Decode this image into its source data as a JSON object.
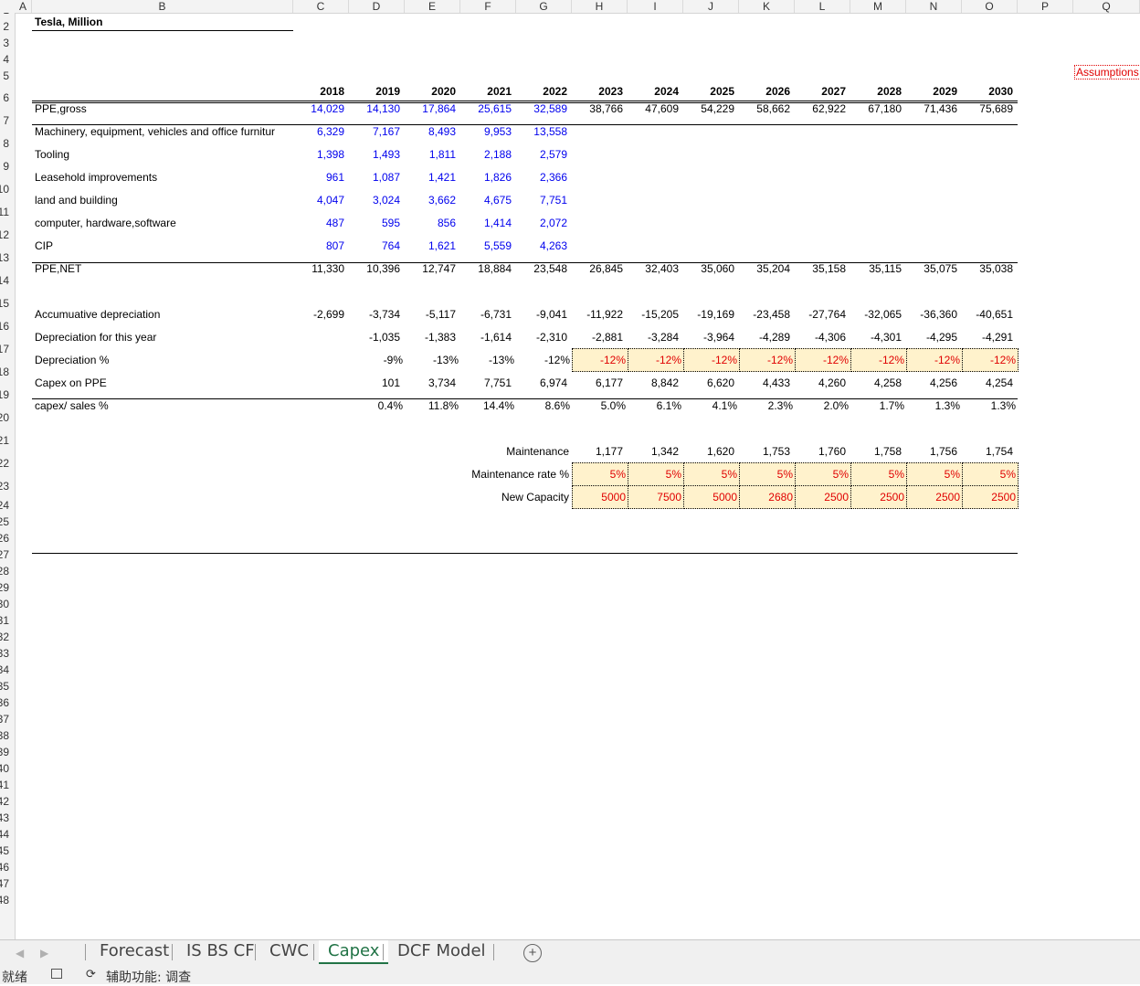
{
  "columns": [
    "A",
    "B",
    "C",
    "D",
    "E",
    "F",
    "G",
    "H",
    "I",
    "J",
    "K",
    "L",
    "M",
    "N",
    "O",
    "P",
    "Q"
  ],
  "rows": [
    "1",
    "2",
    "3",
    "4",
    "5",
    "6",
    "7",
    "8",
    "9",
    "10",
    "11",
    "12",
    "13",
    "14",
    "15",
    "16",
    "17",
    "18",
    "19",
    "20",
    "21",
    "22",
    "23",
    "24",
    "25",
    "26",
    "27",
    "28",
    "29",
    "30",
    "31",
    "32",
    "33",
    "34",
    "35",
    "36",
    "37",
    "38",
    "39",
    "40",
    "41",
    "42",
    "43",
    "44",
    "45",
    "46",
    "47",
    "48"
  ],
  "title": "Tesla, Million",
  "assumptions_label": "Assumptions",
  "years": [
    "2018",
    "2019",
    "2020",
    "2021",
    "2022",
    "2023",
    "2024",
    "2025",
    "2026",
    "2027",
    "2028",
    "2029",
    "2030"
  ],
  "table": [
    {
      "label": "PPE,gross",
      "values": [
        "14,029",
        "14,130",
        "17,864",
        "25,615",
        "32,589",
        "38,766",
        "47,609",
        "54,229",
        "58,662",
        "62,922",
        "67,180",
        "71,436",
        "75,689"
      ],
      "hist_blue": true
    },
    {
      "label": "Machinery, equipment, vehicles and office furnitur",
      "values": [
        "6,329",
        "7,167",
        "8,493",
        "9,953",
        "13,558"
      ],
      "hist_blue": true
    },
    {
      "label": "Tooling",
      "values": [
        "1,398",
        "1,493",
        "1,811",
        "2,188",
        "2,579"
      ],
      "hist_blue": true
    },
    {
      "label": "Leasehold improvements",
      "values": [
        "961",
        "1,087",
        "1,421",
        "1,826",
        "2,366"
      ],
      "hist_blue": true
    },
    {
      "label": "land and building",
      "values": [
        "4,047",
        "3,024",
        "3,662",
        "4,675",
        "7,751"
      ],
      "hist_blue": true
    },
    {
      "label": "computer, hardware,software",
      "values": [
        "487",
        "595",
        "856",
        "1,414",
        "2,072"
      ],
      "hist_blue": true
    },
    {
      "label": "CIP",
      "values": [
        "807",
        "764",
        "1,621",
        "5,559",
        "4,263"
      ],
      "hist_blue": true
    },
    {
      "label": "PPE,NET",
      "values": [
        "11,330",
        "10,396",
        "12,747",
        "18,884",
        "23,548",
        "26,845",
        "32,403",
        "35,060",
        "35,204",
        "35,158",
        "35,115",
        "35,075",
        "35,038"
      ],
      "hist_blue": false
    },
    {
      "label": "",
      "values": []
    },
    {
      "label": "Accumuative depreciation",
      "values": [
        "-2,699",
        "-3,734",
        "-5,117",
        "-6,731",
        "-9,041",
        "-11,922",
        "-15,205",
        "-19,169",
        "-23,458",
        "-27,764",
        "-32,065",
        "-36,360",
        "-40,651"
      ],
      "hist_blue": false
    },
    {
      "label": "Depreciation for this year",
      "values": [
        "",
        "-1,035",
        "-1,383",
        "-1,614",
        "-2,310",
        "-2,881",
        "-3,284",
        "-3,964",
        "-4,289",
        "-4,306",
        "-4,301",
        "-4,295",
        "-4,291"
      ],
      "hist_blue": false
    },
    {
      "label": "Depreciation %",
      "values": [
        "",
        "-9%",
        "-13%",
        "-13%",
        "-12%",
        "-12%",
        "-12%",
        "-12%",
        "-12%",
        "-12%",
        "-12%",
        "-12%",
        "-12%"
      ],
      "hist_blue": false
    },
    {
      "label": "Capex on PPE",
      "values": [
        "",
        "101",
        "3,734",
        "7,751",
        "6,974",
        "6,177",
        "8,842",
        "6,620",
        "4,433",
        "4,260",
        "4,258",
        "4,256",
        "4,254"
      ],
      "hist_blue": false
    },
    {
      "label": "capex/ sales %",
      "values": [
        "",
        "0.4%",
        "11.8%",
        "14.4%",
        "8.6%",
        "5.0%",
        "6.1%",
        "4.1%",
        "2.3%",
        "2.0%",
        "1.7%",
        "1.3%",
        "1.3%"
      ],
      "hist_blue": false
    }
  ],
  "lower": [
    {
      "label": "Maintenance",
      "values": [
        "1,177",
        "1,342",
        "1,620",
        "1,753",
        "1,760",
        "1,758",
        "1,756",
        "1,754"
      ],
      "input": false
    },
    {
      "label": "Maintenance rate %",
      "values": [
        "5%",
        "5%",
        "5%",
        "5%",
        "5%",
        "5%",
        "5%",
        "5%"
      ],
      "input": true
    },
    {
      "label": "New Capacity",
      "values": [
        "5000",
        "7500",
        "5000",
        "2680",
        "2500",
        "2500",
        "2500",
        "2500"
      ],
      "input": true
    }
  ],
  "tabs": [
    "Forecast",
    "IS BS CF",
    "CWC",
    "Capex",
    "DCF Model"
  ],
  "active_tab": "Capex",
  "status": {
    "ready": "就绪",
    "accessibility": "辅助功能: 调查"
  },
  "colors": {
    "input_fill": "#fff2cc",
    "input_text": "#e00000",
    "hist_text": "#0000ee",
    "active_tab": "#217346"
  },
  "icons": {
    "add_sheet": "plus-circle-icon",
    "prev": "chevron-left-icon",
    "next": "chevron-right-icon",
    "macro": "macro-record-icon",
    "accessibility": "accessibility-icon"
  }
}
